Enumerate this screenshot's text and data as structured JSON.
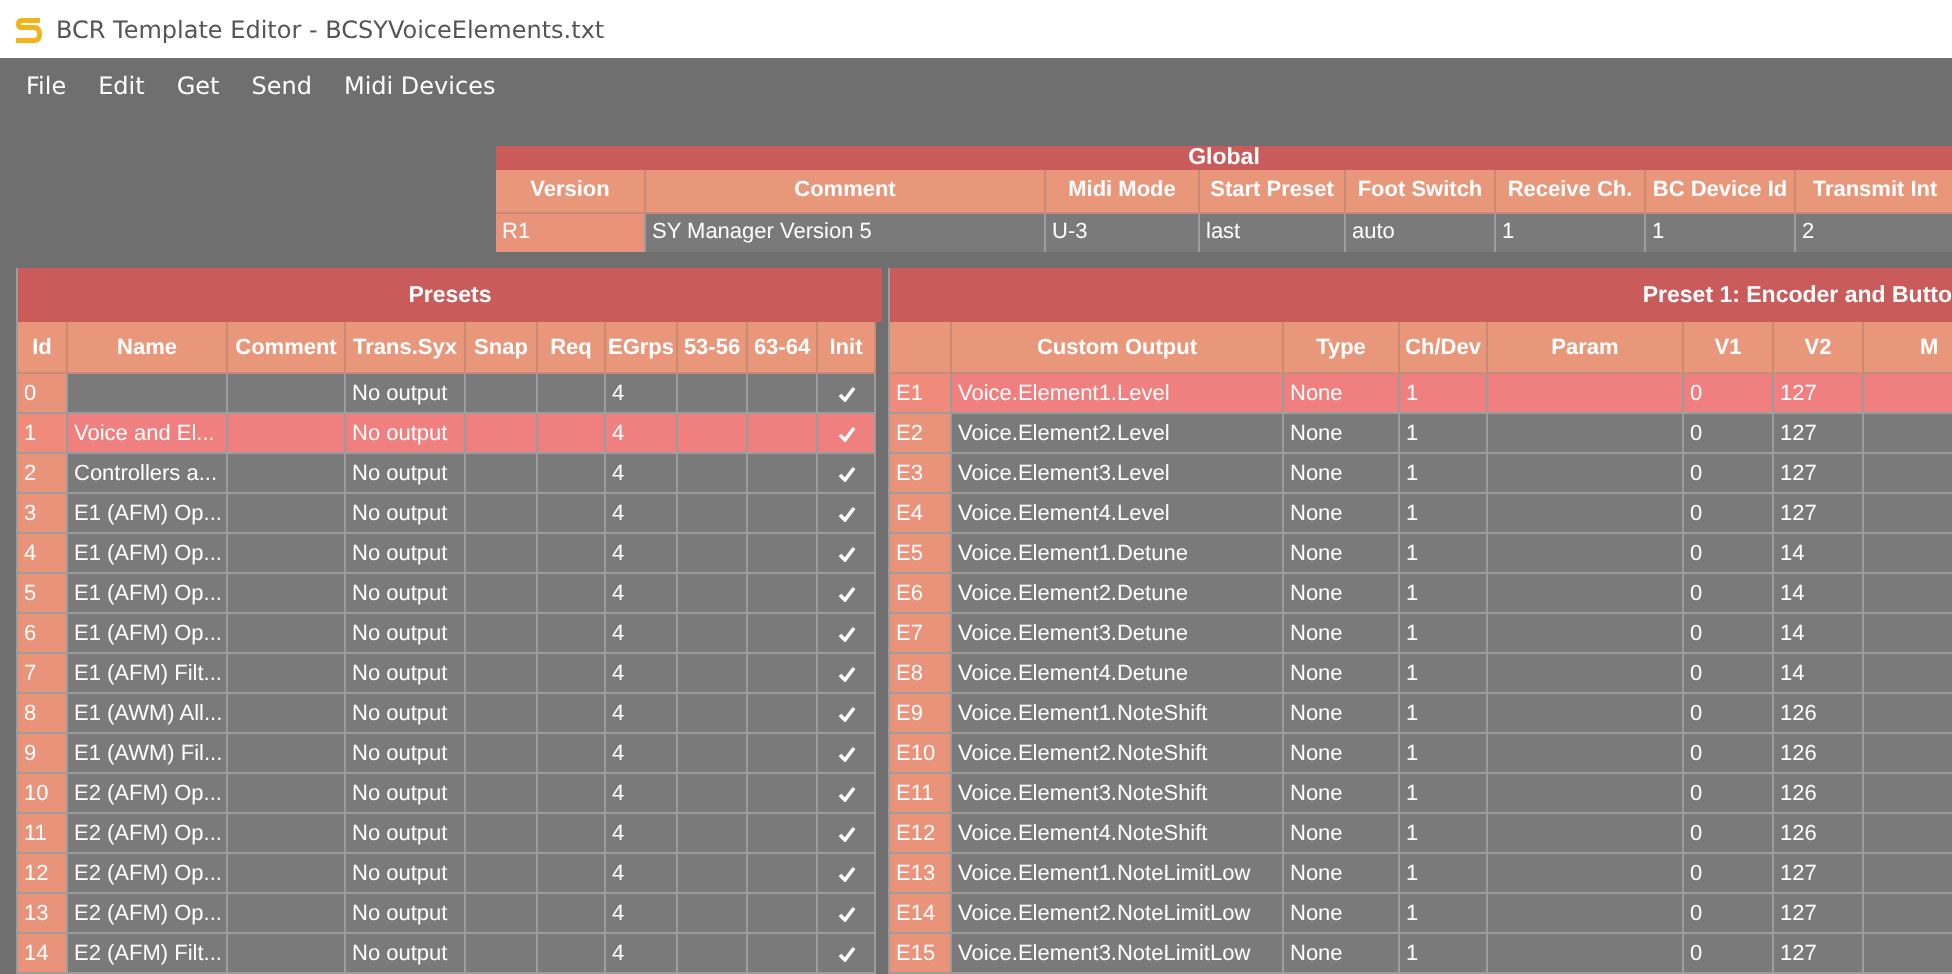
{
  "window": {
    "title": "BCR Template Editor - BCSYVoiceElements.txt"
  },
  "menu": [
    "File",
    "Edit",
    "Get",
    "Send",
    "Midi Devices"
  ],
  "global": {
    "title": "Global",
    "columns": [
      "Version",
      "Comment",
      "Midi Mode",
      "Start Preset",
      "Foot Switch",
      "Receive Ch.",
      "BC Device Id",
      "Transmit Int"
    ],
    "rows": [
      {
        "cells": [
          "R1",
          "SY Manager Version 5",
          "U-3",
          "last",
          "auto",
          "1",
          "1",
          "2"
        ],
        "selected": false
      }
    ]
  },
  "presets": {
    "title": "Presets",
    "columns": [
      "Id",
      "Name",
      "Comment",
      "Trans.Syx",
      "Snap",
      "Req",
      "EGrps",
      "53-56",
      "63-64",
      "Init"
    ],
    "rows": [
      {
        "cells": [
          "0",
          null,
          null,
          "No output",
          null,
          null,
          "4",
          null,
          null,
          true
        ],
        "selected": false
      },
      {
        "cells": [
          "1",
          "Voice and El...",
          null,
          "No output",
          null,
          null,
          "4",
          null,
          null,
          true
        ],
        "selected": true
      },
      {
        "cells": [
          "2",
          "Controllers a...",
          null,
          "No output",
          null,
          null,
          "4",
          null,
          null,
          true
        ],
        "selected": false
      },
      {
        "cells": [
          "3",
          "E1 (AFM) Op...",
          null,
          "No output",
          null,
          null,
          "4",
          null,
          null,
          true
        ],
        "selected": false
      },
      {
        "cells": [
          "4",
          "E1 (AFM) Op...",
          null,
          "No output",
          null,
          null,
          "4",
          null,
          null,
          true
        ],
        "selected": false
      },
      {
        "cells": [
          "5",
          "E1 (AFM) Op...",
          null,
          "No output",
          null,
          null,
          "4",
          null,
          null,
          true
        ],
        "selected": false
      },
      {
        "cells": [
          "6",
          "E1 (AFM) Op...",
          null,
          "No output",
          null,
          null,
          "4",
          null,
          null,
          true
        ],
        "selected": false
      },
      {
        "cells": [
          "7",
          "E1 (AFM) Filt...",
          null,
          "No output",
          null,
          null,
          "4",
          null,
          null,
          true
        ],
        "selected": false
      },
      {
        "cells": [
          "8",
          "E1 (AWM) All...",
          null,
          "No output",
          null,
          null,
          "4",
          null,
          null,
          true
        ],
        "selected": false
      },
      {
        "cells": [
          "9",
          "E1 (AWM) Fil...",
          null,
          "No output",
          null,
          null,
          "4",
          null,
          null,
          true
        ],
        "selected": false
      },
      {
        "cells": [
          "10",
          "E2 (AFM) Op...",
          null,
          "No output",
          null,
          null,
          "4",
          null,
          null,
          true
        ],
        "selected": false
      },
      {
        "cells": [
          "11",
          "E2 (AFM) Op...",
          null,
          "No output",
          null,
          null,
          "4",
          null,
          null,
          true
        ],
        "selected": false
      },
      {
        "cells": [
          "12",
          "E2 (AFM) Op...",
          null,
          "No output",
          null,
          null,
          "4",
          null,
          null,
          true
        ],
        "selected": false
      },
      {
        "cells": [
          "13",
          "E2 (AFM) Op...",
          null,
          "No output",
          null,
          null,
          "4",
          null,
          null,
          true
        ],
        "selected": false
      },
      {
        "cells": [
          "14",
          "E2 (AFM) Filt...",
          null,
          "No output",
          null,
          null,
          "4",
          null,
          null,
          true
        ],
        "selected": false
      }
    ]
  },
  "encoders": {
    "title": "Preset 1: Encoder and Butto",
    "columns": [
      null,
      "Custom Output",
      "Type",
      "Ch/Dev",
      "Param",
      "V1",
      "V2",
      "M"
    ],
    "rows": [
      {
        "cells": [
          "E1",
          "Voice.Element1.Level",
          "None",
          "1",
          null,
          "0",
          "127",
          null
        ],
        "selected": true
      },
      {
        "cells": [
          "E2",
          "Voice.Element2.Level",
          "None",
          "1",
          null,
          "0",
          "127",
          null
        ],
        "selected": false
      },
      {
        "cells": [
          "E3",
          "Voice.Element3.Level",
          "None",
          "1",
          null,
          "0",
          "127",
          null
        ],
        "selected": false
      },
      {
        "cells": [
          "E4",
          "Voice.Element4.Level",
          "None",
          "1",
          null,
          "0",
          "127",
          null
        ],
        "selected": false
      },
      {
        "cells": [
          "E5",
          "Voice.Element1.Detune",
          "None",
          "1",
          null,
          "0",
          "14",
          null
        ],
        "selected": false
      },
      {
        "cells": [
          "E6",
          "Voice.Element2.Detune",
          "None",
          "1",
          null,
          "0",
          "14",
          null
        ],
        "selected": false
      },
      {
        "cells": [
          "E7",
          "Voice.Element3.Detune",
          "None",
          "1",
          null,
          "0",
          "14",
          null
        ],
        "selected": false
      },
      {
        "cells": [
          "E8",
          "Voice.Element4.Detune",
          "None",
          "1",
          null,
          "0",
          "14",
          null
        ],
        "selected": false
      },
      {
        "cells": [
          "E9",
          "Voice.Element1.NoteShift",
          "None",
          "1",
          null,
          "0",
          "126",
          null
        ],
        "selected": false
      },
      {
        "cells": [
          "E10",
          "Voice.Element2.NoteShift",
          "None",
          "1",
          null,
          "0",
          "126",
          null
        ],
        "selected": false
      },
      {
        "cells": [
          "E11",
          "Voice.Element3.NoteShift",
          "None",
          "1",
          null,
          "0",
          "126",
          null
        ],
        "selected": false
      },
      {
        "cells": [
          "E12",
          "Voice.Element4.NoteShift",
          "None",
          "1",
          null,
          "0",
          "126",
          null
        ],
        "selected": false
      },
      {
        "cells": [
          "E13",
          "Voice.Element1.NoteLimitLow",
          "None",
          "1",
          null,
          "0",
          "127",
          null
        ],
        "selected": false
      },
      {
        "cells": [
          "E14",
          "Voice.Element2.NoteLimitLow",
          "None",
          "1",
          null,
          "0",
          "127",
          null
        ],
        "selected": false
      },
      {
        "cells": [
          "E15",
          "Voice.Element3.NoteLimitLow",
          "None",
          "1",
          null,
          "0",
          "127",
          null
        ],
        "selected": false
      }
    ]
  }
}
